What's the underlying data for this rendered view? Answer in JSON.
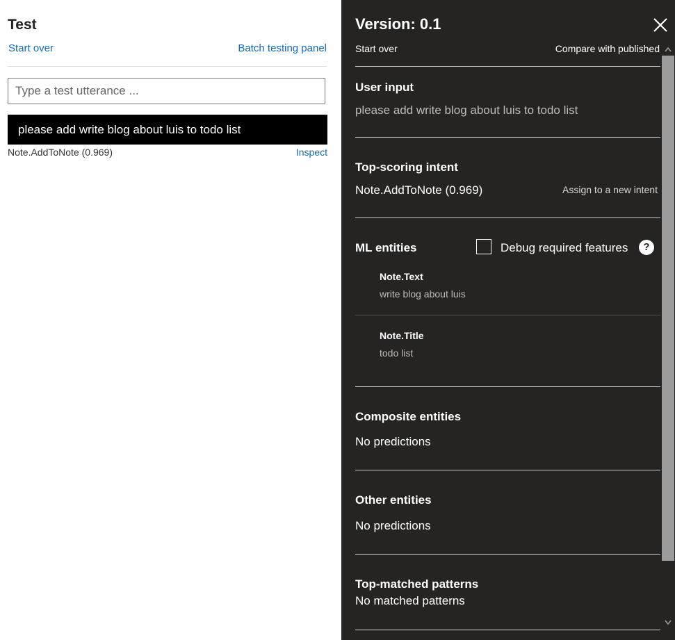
{
  "test_panel": {
    "title": "Test",
    "start_over": "Start over",
    "batch_testing": "Batch testing panel",
    "input_placeholder": "Type a test utterance ...",
    "utterance": "please add write blog about luis to todo list",
    "top_intent_result": "Note.AddToNote (0.969)",
    "inspect": "Inspect"
  },
  "inspect_panel": {
    "version_title": "Version: 0.1",
    "start_over": "Start over",
    "compare": "Compare with published",
    "user_input": {
      "heading": "User input",
      "value": "please add write blog about luis to todo list"
    },
    "top_scoring_intent": {
      "heading": "Top-scoring intent",
      "value": "Note.AddToNote (0.969)",
      "assign": "Assign to a new intent"
    },
    "ml_entities": {
      "heading": "ML entities",
      "debug_label": "Debug required features",
      "help": "?",
      "items": [
        {
          "name": "Note.Text",
          "value": "write blog about luis"
        },
        {
          "name": "Note.Title",
          "value": "todo list"
        }
      ]
    },
    "composite_entities": {
      "heading": "Composite entities",
      "value": "No predictions"
    },
    "other_entities": {
      "heading": "Other entities",
      "value": "No predictions"
    },
    "top_matched_patterns": {
      "heading": "Top-matched patterns",
      "value": "No matched patterns"
    }
  },
  "icons": {
    "close": "close-icon",
    "help": "help-icon",
    "scroll_up": "chevron-up-icon",
    "scroll_down": "chevron-down-icon"
  },
  "colors": {
    "panel_bg": "#252423",
    "link": "#0f6cbd",
    "utterance_bg": "#000000"
  }
}
